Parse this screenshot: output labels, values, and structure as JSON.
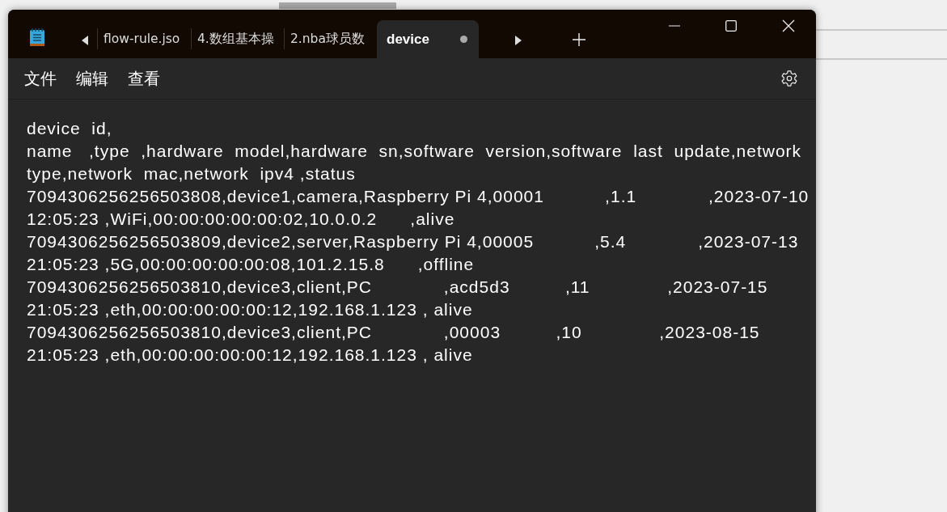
{
  "window": {
    "tabs": [
      {
        "label": "flow-rule.jso",
        "selected": false,
        "modified": false
      },
      {
        "label": "4.数组基本操",
        "selected": false,
        "modified": false
      },
      {
        "label": "2.nba球员数",
        "selected": false,
        "modified": false
      },
      {
        "label": "device",
        "selected": true,
        "modified": true
      }
    ]
  },
  "menu": [
    "文件",
    "编辑",
    "查看"
  ],
  "editor": {
    "lines": [
      "device  id,",
      "name   ,type  ,hardware  model,hardware  sn,software  version,software  last  update,network",
      "type,network  mac,network  ipv4 ,status",
      "7094306256256503808,device1,camera,Raspberry Pi 4,00001           ,1.1             ,2023-07-10",
      "12:05:23 ,WiFi,00:00:00:00:00:02,10.0.0.2      ,alive",
      "7094306256256503809,device2,server,Raspberry Pi 4,00005           ,5.4             ,2023-07-13",
      "21:05:23 ,5G,00:00:00:00:00:08,101.2.15.8      ,offline",
      "7094306256256503810,device3,client,PC             ,acd5d3          ,11              ,2023-07-15",
      "21:05:23 ,eth,00:00:00:00:00:12,192.168.1.123 , alive",
      "7094306256256503810,device3,client,PC             ,00003          ,10              ,2023-08-15",
      "21:05:23 ,eth,00:00:00:00:00:12,192.168.1.123 , alive"
    ]
  }
}
